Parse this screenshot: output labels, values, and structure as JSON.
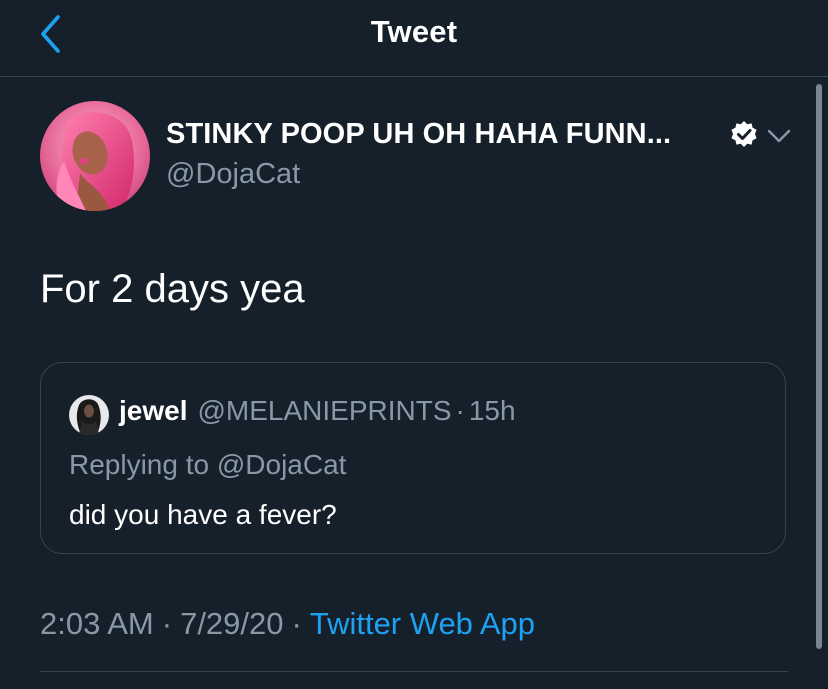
{
  "header": {
    "title": "Tweet"
  },
  "tweet": {
    "display_name": "STINKY POOP UH OH HAHA FUNN...",
    "handle": "@DojaCat",
    "text": "For 2 days yea",
    "time": "2:03 AM",
    "separator": "·",
    "date": "7/29/20",
    "source": "Twitter Web App"
  },
  "quoted_tweet": {
    "name": "jewel",
    "handle": "@MELANIEPRINTS",
    "separator": "·",
    "time": "15h",
    "replying_to": "Replying to @DojaCat",
    "text": "did you have a fever?"
  },
  "icons": {
    "back": "chevron-left-icon",
    "verified": "verified-badge-icon",
    "menu": "chevron-down-icon"
  },
  "colors": {
    "background": "#15202b",
    "accent": "#1da1f2",
    "secondary_text": "#8899a6",
    "border": "#38444d"
  }
}
